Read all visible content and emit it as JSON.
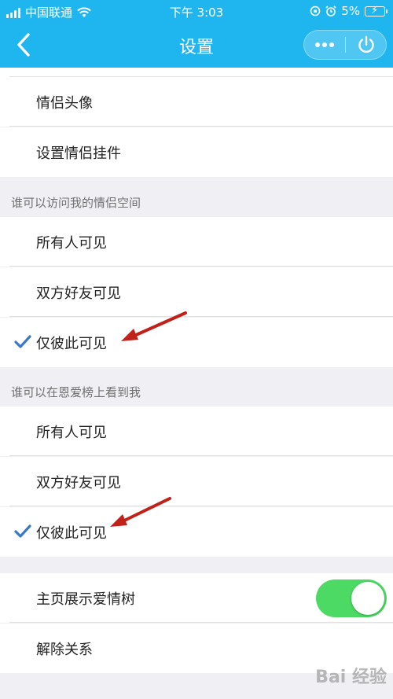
{
  "status_bar": {
    "carrier": "中国联通",
    "time": "下午 3:03",
    "battery_percent": "5%"
  },
  "nav": {
    "title": "设置",
    "back_icon": "chevron-left-icon",
    "more_icon": "more-dots-icon",
    "power_icon": "power-icon"
  },
  "profile_section": {
    "items": [
      {
        "label": "情侣头像"
      },
      {
        "label": "设置情侣挂件"
      }
    ]
  },
  "visit_section": {
    "header": "谁可以访问我的情侣空间",
    "options": [
      {
        "label": "所有人可见",
        "selected": false
      },
      {
        "label": "双方好友可见",
        "selected": false
      },
      {
        "label": "仅彼此可见",
        "selected": true
      }
    ]
  },
  "rank_section": {
    "header": "谁可以在恩爱榜上看到我",
    "options": [
      {
        "label": "所有人可见",
        "selected": false
      },
      {
        "label": "双方好友可见",
        "selected": false
      },
      {
        "label": "仅彼此可见",
        "selected": true
      }
    ]
  },
  "misc_section": {
    "love_tree": {
      "label": "主页展示爱情树",
      "enabled": true
    },
    "unbind": {
      "label": "解除关系"
    }
  },
  "colors": {
    "nav_bg": "#1fb6ef",
    "check": "#3a78c9",
    "toggle_on": "#4cd964",
    "annotation_arrow": "#c0221a"
  },
  "watermark": "Bai 经验"
}
